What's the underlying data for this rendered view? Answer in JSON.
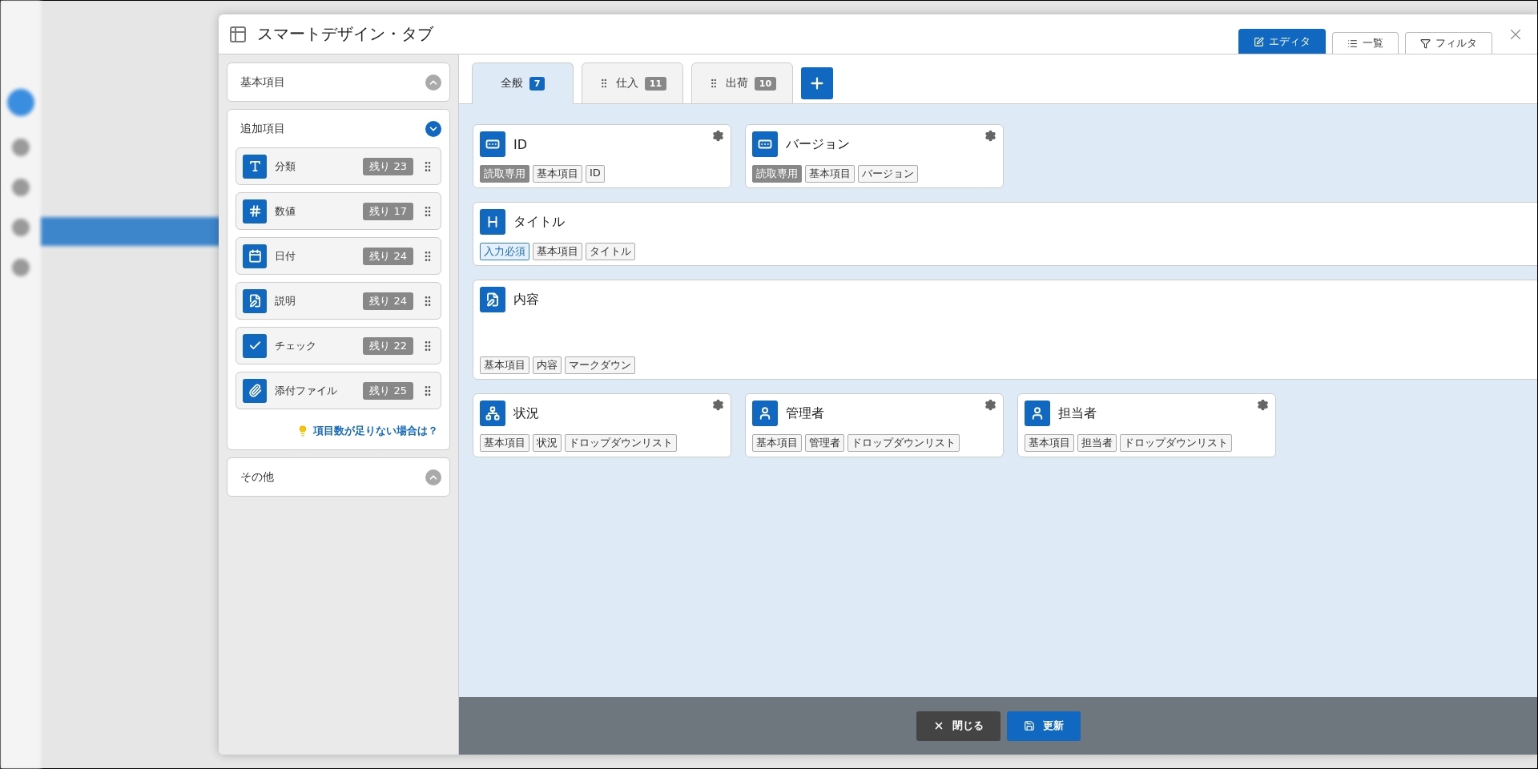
{
  "dialog": {
    "title": "スマートデザイン・タブ",
    "views": [
      {
        "label": "エディタ",
        "kind": "editor",
        "selected": true
      },
      {
        "label": "一覧",
        "kind": "list",
        "selected": false
      },
      {
        "label": "フィルタ",
        "kind": "filter",
        "selected": false
      }
    ]
  },
  "sidebar": {
    "sections": [
      {
        "title": "基本項目",
        "expanded": false
      },
      {
        "title": "追加項目",
        "expanded": true,
        "items": [
          {
            "label": "分類",
            "kind": "class",
            "remaining": "残り 23"
          },
          {
            "label": "数値",
            "kind": "num",
            "remaining": "残り 17"
          },
          {
            "label": "日付",
            "kind": "date",
            "remaining": "残り 24"
          },
          {
            "label": "説明",
            "kind": "description",
            "remaining": "残り 24"
          },
          {
            "label": "チェック",
            "kind": "check",
            "remaining": "残り 22"
          },
          {
            "label": "添付ファイル",
            "kind": "attachment",
            "remaining": "残り 25"
          }
        ],
        "help_link": "項目数が足りない場合は？"
      },
      {
        "title": "その他",
        "expanded": false
      }
    ]
  },
  "tabs": [
    {
      "label": "全般",
      "count": "7",
      "selected": true
    },
    {
      "label": "仕入",
      "count": "11",
      "selected": false
    },
    {
      "label": "出荷",
      "count": "10",
      "selected": false
    }
  ],
  "fields": [
    {
      "title": "ID",
      "kind": "number",
      "tags": [
        {
          "label": "読取専用",
          "kind": "readonly"
        },
        {
          "label": "基本項目",
          "kind": "plain"
        },
        {
          "label": "ID",
          "kind": "plain"
        }
      ]
    },
    {
      "title": "バージョン",
      "kind": "number",
      "tags": [
        {
          "label": "読取専用",
          "kind": "readonly"
        },
        {
          "label": "基本項目",
          "kind": "plain"
        },
        {
          "label": "バージョン",
          "kind": "plain"
        }
      ]
    },
    {
      "title": "タイトル",
      "kind": "title",
      "tags": [
        {
          "label": "入力必須",
          "kind": "required"
        },
        {
          "label": "基本項目",
          "kind": "plain"
        },
        {
          "label": "タイトル",
          "kind": "plain"
        }
      ]
    },
    {
      "title": "内容",
      "kind": "markdown",
      "tags": [
        {
          "label": "基本項目",
          "kind": "plain"
        },
        {
          "label": "内容",
          "kind": "plain"
        },
        {
          "label": "マークダウン",
          "kind": "plain"
        }
      ]
    },
    {
      "title": "状況",
      "kind": "status",
      "tags": [
        {
          "label": "基本項目",
          "kind": "plain"
        },
        {
          "label": "状況",
          "kind": "plain"
        },
        {
          "label": "ドロップダウンリスト",
          "kind": "plain"
        }
      ]
    },
    {
      "title": "管理者",
      "kind": "user",
      "tags": [
        {
          "label": "基本項目",
          "kind": "plain"
        },
        {
          "label": "管理者",
          "kind": "plain"
        },
        {
          "label": "ドロップダウンリスト",
          "kind": "plain"
        }
      ]
    },
    {
      "title": "担当者",
      "kind": "user",
      "tags": [
        {
          "label": "基本項目",
          "kind": "plain"
        },
        {
          "label": "担当者",
          "kind": "plain"
        },
        {
          "label": "ドロップダウンリスト",
          "kind": "plain"
        }
      ]
    }
  ],
  "footer": {
    "buttons": [
      {
        "label": "閉じる",
        "kind": "close"
      },
      {
        "label": "更新",
        "kind": "save"
      }
    ]
  }
}
